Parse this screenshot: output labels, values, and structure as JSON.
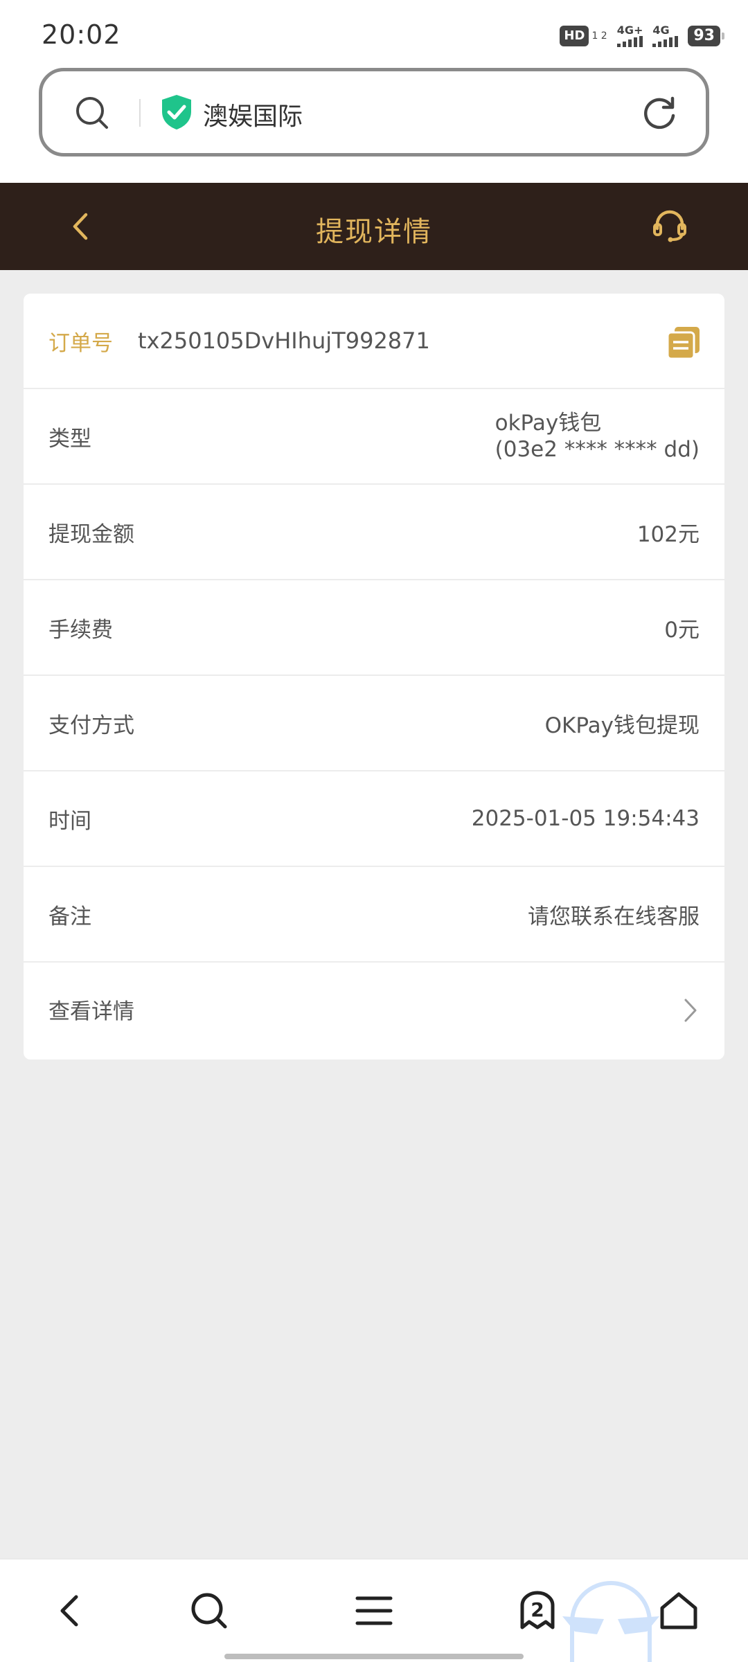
{
  "status_bar": {
    "time": "20:02",
    "hd_label": "HD",
    "hd_sub": "1 2",
    "net1": "4G+",
    "net2": "4G",
    "battery": "93"
  },
  "browser": {
    "site_title": "澳娱国际",
    "icons": [
      "search-icon",
      "shield-check-icon",
      "refresh-icon"
    ]
  },
  "header": {
    "title": "提现详情",
    "back_icon": "chevron-left-icon",
    "support_icon": "headset-icon"
  },
  "details": {
    "order": {
      "label": "订单号",
      "value": "tx250105DvHIhujT992871"
    },
    "rows": [
      {
        "label": "类型",
        "value_line1": "okPay钱包",
        "value_line2": "(03e2 **** **** dd)"
      },
      {
        "label": "提现金额",
        "value": "102元"
      },
      {
        "label": "手续费",
        "value": "0元"
      },
      {
        "label": "支付方式",
        "value": "OKPay钱包提现"
      },
      {
        "label": "时间",
        "value": "2025-01-05 19:54:43"
      },
      {
        "label": "备注",
        "value": "请您联系在线客服"
      }
    ],
    "view_details": {
      "label": "查看详情"
    }
  },
  "bottom_nav": {
    "tabs_count": "2",
    "items": [
      "back-icon",
      "search-icon",
      "menu-icon",
      "tabs-icon",
      "home-icon"
    ]
  },
  "colors": {
    "accent_gold": "#e2b65d",
    "header_bg": "#2e201a",
    "page_bg": "#ededed",
    "shield_green": "#1fc48b"
  }
}
